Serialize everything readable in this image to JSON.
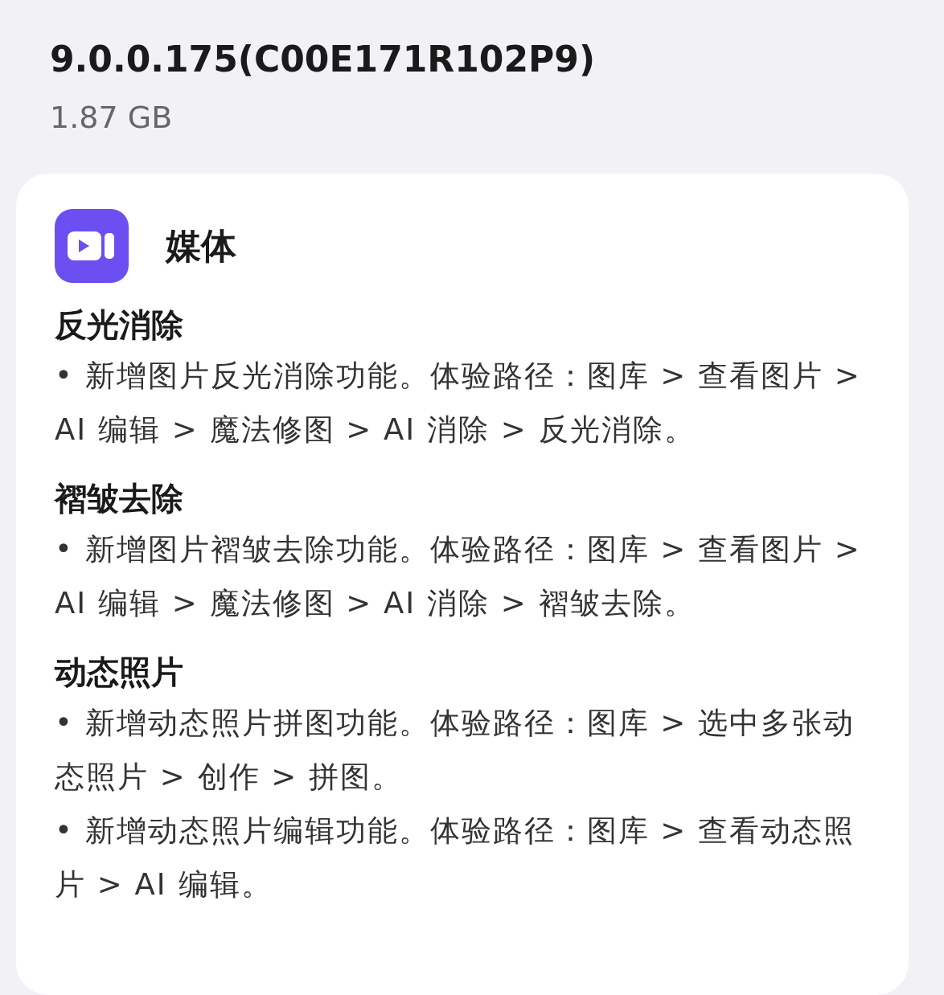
{
  "version": "9.0.0.175(C00E171R102P9)",
  "size": "1.87 GB",
  "card": {
    "title": "媒体",
    "sections": [
      {
        "heading": "反光消除",
        "items": [
          "• 新增图片反光消除功能。体验路径：图库 > 查看图片 > AI 编辑 > 魔法修图 > AI 消除 > 反光消除。"
        ]
      },
      {
        "heading": "褶皱去除",
        "items": [
          "• 新增图片褶皱去除功能。体验路径：图库 > 查看图片 > AI 编辑 > 魔法修图 > AI 消除 > 褶皱去除。"
        ]
      },
      {
        "heading": "动态照片",
        "items": [
          "• 新增动态照片拼图功能。体验路径：图库 > 选中多张动态照片 > 创作 > 拼图。",
          "• 新增动态照片编辑功能。体验路径：图库 > 查看动态照片 > AI 编辑。"
        ]
      }
    ]
  }
}
